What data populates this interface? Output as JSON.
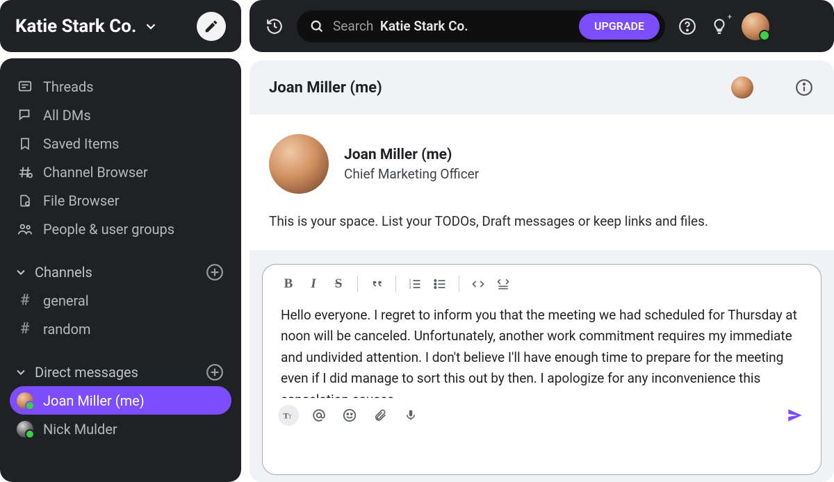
{
  "workspace": {
    "name": "Katie Stark Co."
  },
  "sidebar": {
    "nav": [
      {
        "label": "Threads",
        "icon": "threads-icon"
      },
      {
        "label": "All DMs",
        "icon": "dms-icon"
      },
      {
        "label": "Saved Items",
        "icon": "bookmark-icon"
      },
      {
        "label": "Channel Browser",
        "icon": "channel-browser-icon"
      },
      {
        "label": "File Browser",
        "icon": "file-browser-icon"
      },
      {
        "label": "People & user groups",
        "icon": "people-icon"
      }
    ],
    "channels_section": "Channels",
    "channels": [
      {
        "label": "general"
      },
      {
        "label": "random"
      }
    ],
    "dms_section": "Direct messages",
    "dms": [
      {
        "label": "Joan Miller (me)",
        "active": true
      },
      {
        "label": "Nick Mulder",
        "active": false
      }
    ]
  },
  "topbar": {
    "search_prefix": "Search",
    "search_bold": "Katie Stark Co.",
    "upgrade": "UPGRADE"
  },
  "header": {
    "title": "Joan Miller (me)"
  },
  "intro": {
    "name": "Joan Miller (me)",
    "role": "Chief Marketing Officer",
    "desc": "This is your space. List your TODOs, Draft messages or keep links and files."
  },
  "composer": {
    "draft": "Hello everyone. I regret to inform you that the meeting we had scheduled for Thursday at noon will be canceled. Unfortunately, another work commitment requires my immediate and undivided attention. I don't believe I'll have enough time to prepare for the meeting even if I did manage to sort this out by then. I apologize for any inconvenience this cancelation causes."
  }
}
